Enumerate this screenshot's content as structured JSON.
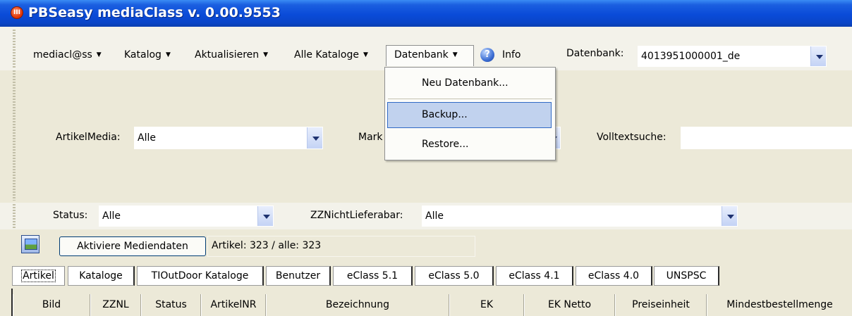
{
  "window": {
    "title": "PBSeasy mediaClass v. 0.00.9553",
    "icon": "app-icon"
  },
  "menubar": {
    "items": [
      {
        "label": "mediacl@ss",
        "has_arrow": true
      },
      {
        "label": "Katalog",
        "has_arrow": true
      },
      {
        "label": "Aktualisieren",
        "has_arrow": true
      },
      {
        "label": "Alle Kataloge",
        "has_arrow": true
      },
      {
        "label": "Datenbank",
        "has_arrow": true,
        "open": true
      },
      {
        "label": "Info",
        "icon": "info-icon"
      }
    ],
    "arrow_glyph": "▼",
    "datenbank_label": "Datenbank:",
    "datenbank_value": "4013951000001_de"
  },
  "dropdown_menu": {
    "items": [
      "Neu Datenbank...",
      "Backup...",
      "Restore..."
    ],
    "highlighted": "Backup..."
  },
  "filters": {
    "artikelmedia_label": "ArtikelMedia:",
    "artikelmedia_value": "Alle",
    "mark_label": "Mark",
    "volltext_label": "Volltextsuche:",
    "volltext_value": "",
    "status_label": "Status:",
    "status_value": "Alle",
    "zznicht_label": "ZZNichtLieferabar:",
    "zznicht_value": "Alle"
  },
  "toolbar": {
    "aktiviere_label": "Aktiviere Mediendaten",
    "count_text": "Artikel: 323 / alle: 323"
  },
  "tabs": [
    "Artikel",
    "Kataloge",
    "TIOutDoor Kataloge",
    "Benutzer",
    "eClass 5.1",
    "eClass 5.0",
    "eClass 4.1",
    "eClass 4.0",
    "UNSPSC"
  ],
  "active_tab": "Artikel",
  "grid": {
    "columns": [
      "Bild",
      "ZZNL",
      "Status",
      "ArtikelNR",
      "Bezeichnung",
      "EK",
      "EK Netto",
      "Preiseinheit",
      "Mindestbestellmenge"
    ]
  },
  "colors": {
    "titlebar": "#0a4bd8",
    "highlight": "#c1d2ee",
    "highlight_border": "#316ac5"
  }
}
